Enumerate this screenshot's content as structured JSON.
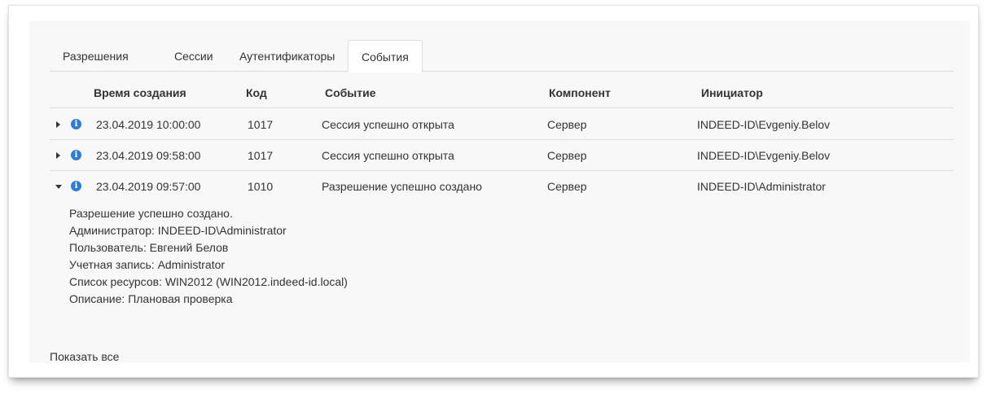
{
  "tabs": [
    {
      "label": "Разрешения",
      "active": false
    },
    {
      "label": "Сессии",
      "active": false
    },
    {
      "label": "Аутентификаторы",
      "active": false
    },
    {
      "label": "События",
      "active": true
    }
  ],
  "columns": {
    "created": "Время создания",
    "code": "Код",
    "event": "Событие",
    "component": "Компонент",
    "initiator": "Инициатор"
  },
  "rows": [
    {
      "expanded": false,
      "created": "23.04.2019 10:00:00",
      "code": "1017",
      "event": "Сессия успешно открыта",
      "component": "Сервер",
      "initiator": "INDEED-ID\\Evgeniy.Belov"
    },
    {
      "expanded": false,
      "created": "23.04.2019 09:58:00",
      "code": "1017",
      "event": "Сессия успешно открыта",
      "component": "Сервер",
      "initiator": "INDEED-ID\\Evgeniy.Belov"
    },
    {
      "expanded": true,
      "created": "23.04.2019 09:57:00",
      "code": "1010",
      "event": "Разрешение успешно создано",
      "component": "Сервер",
      "initiator": "INDEED-ID\\Administrator"
    }
  ],
  "details": [
    "Разрешение успешно создано.",
    "Администратор: INDEED-ID\\Administrator",
    "Пользователь: Евгений Белов",
    "Учетная запись: Administrator",
    "Список ресурсов: WIN2012 (WIN2012.indeed-id.local)",
    "Описание: Плановая проверка"
  ],
  "show_all": "Показать все",
  "icons": {
    "info": "info-icon",
    "expand": "caret-right-icon",
    "collapse": "caret-down-icon"
  },
  "colors": {
    "info_icon": "#2f7cd8",
    "panel_bg": "#f8f8f8",
    "border": "#dddddd"
  }
}
